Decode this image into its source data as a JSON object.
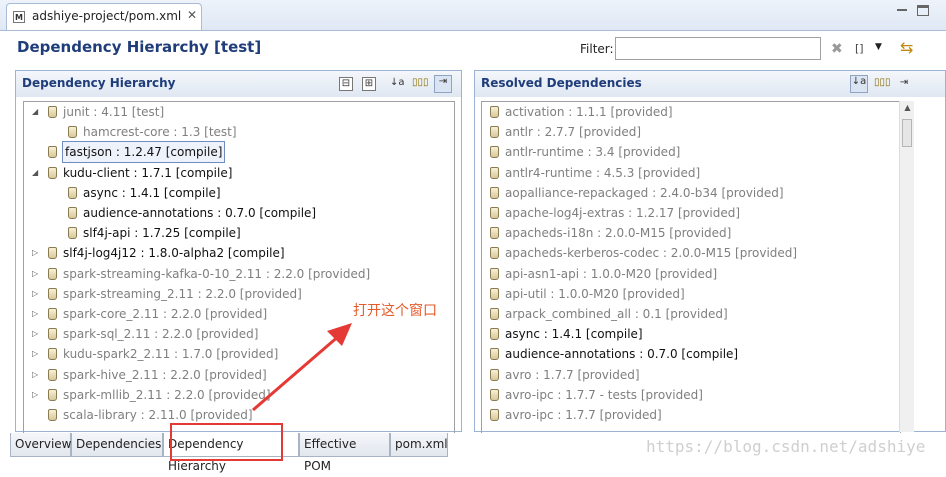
{
  "editor_tab": {
    "icon": "M",
    "title": "adshiye-project/pom.xml",
    "close": "✕"
  },
  "header": {
    "title": "Dependency Hierarchy [test]",
    "filter_label": "Filter:",
    "filter_value": "",
    "filter_placeholder": ""
  },
  "toolbar_icons": {
    "clear": "✖",
    "bracket": "[]",
    "dropdown": "▼",
    "sync": "⇆"
  },
  "left": {
    "title": "Dependency Hierarchy",
    "tools": [
      "⊟",
      "⊞",
      "↓a",
      "▯▯▯",
      "⇥"
    ],
    "items": [
      {
        "label": "junit : 4.11 [test]",
        "level": 0,
        "exp": "◢",
        "style": "grey"
      },
      {
        "label": "hamcrest-core : 1.3 [test]",
        "level": 1,
        "exp": "",
        "style": "grey"
      },
      {
        "label": "fastjson : 1.2.47 [compile]",
        "level": 0,
        "exp": "",
        "style": "dark sel"
      },
      {
        "label": "kudu-client : 1.7.1 [compile]",
        "level": 0,
        "exp": "◢",
        "style": "dark"
      },
      {
        "label": "async : 1.4.1 [compile]",
        "level": 1,
        "exp": "",
        "style": "dark"
      },
      {
        "label": "audience-annotations : 0.7.0 [compile]",
        "level": 1,
        "exp": "",
        "style": "dark"
      },
      {
        "label": "slf4j-api : 1.7.25 [compile]",
        "level": 1,
        "exp": "",
        "style": "dark"
      },
      {
        "label": "slf4j-log4j12 : 1.8.0-alpha2 [compile]",
        "level": 0,
        "exp": "▷",
        "style": "dark"
      },
      {
        "label": "spark-streaming-kafka-0-10_2.11 : 2.2.0 [provided]",
        "level": 0,
        "exp": "▷",
        "style": "grey"
      },
      {
        "label": "spark-streaming_2.11 : 2.2.0 [provided]",
        "level": 0,
        "exp": "▷",
        "style": "grey"
      },
      {
        "label": "spark-core_2.11 : 2.2.0 [provided]",
        "level": 0,
        "exp": "▷",
        "style": "grey"
      },
      {
        "label": "spark-sql_2.11 : 2.2.0 [provided]",
        "level": 0,
        "exp": "▷",
        "style": "grey"
      },
      {
        "label": "kudu-spark2_2.11 : 1.7.0 [provided]",
        "level": 0,
        "exp": "▷",
        "style": "grey"
      },
      {
        "label": "spark-hive_2.11 : 2.2.0 [provided]",
        "level": 0,
        "exp": "▷",
        "style": "grey"
      },
      {
        "label": "spark-mllib_2.11 : 2.2.0 [provided]",
        "level": 0,
        "exp": "▷",
        "style": "grey"
      },
      {
        "label": "scala-library : 2.11.0 [provided]",
        "level": 0,
        "exp": "",
        "style": "grey"
      }
    ]
  },
  "right": {
    "title": "Resolved Dependencies",
    "tools": [
      "↓a",
      "▯▯▯",
      "⇥"
    ],
    "items": [
      {
        "label": "activation : 1.1.1 [provided]",
        "style": "grey"
      },
      {
        "label": "antlr : 2.7.7 [provided]",
        "style": "grey"
      },
      {
        "label": "antlr-runtime : 3.4 [provided]",
        "style": "grey"
      },
      {
        "label": "antlr4-runtime : 4.5.3 [provided]",
        "style": "grey"
      },
      {
        "label": "aopalliance-repackaged : 2.4.0-b34 [provided]",
        "style": "grey"
      },
      {
        "label": "apache-log4j-extras : 1.2.17 [provided]",
        "style": "grey"
      },
      {
        "label": "apacheds-i18n : 2.0.0-M15 [provided]",
        "style": "grey"
      },
      {
        "label": "apacheds-kerberos-codec : 2.0.0-M15 [provided]",
        "style": "grey"
      },
      {
        "label": "api-asn1-api : 1.0.0-M20 [provided]",
        "style": "grey"
      },
      {
        "label": "api-util : 1.0.0-M20 [provided]",
        "style": "grey"
      },
      {
        "label": "arpack_combined_all : 0.1 [provided]",
        "style": "grey"
      },
      {
        "label": "async : 1.4.1 [compile]",
        "style": "dark"
      },
      {
        "label": "audience-annotations : 0.7.0 [compile]",
        "style": "dark"
      },
      {
        "label": "avro : 1.7.7 [provided]",
        "style": "grey"
      },
      {
        "label": "avro-ipc : 1.7.7 - tests [provided]",
        "style": "grey"
      },
      {
        "label": "avro-ipc : 1.7.7 [provided]",
        "style": "grey"
      }
    ]
  },
  "bottom_tabs": [
    "Overview",
    "Dependencies",
    "Dependency Hierarchy",
    "Effective POM",
    "pom.xml"
  ],
  "active_tab": "Dependency Hierarchy",
  "annotation": "打开这个窗口",
  "watermark": "https://blog.csdn.net/adshiye",
  "colors": {
    "title_blue": "#1f3d7a",
    "annotation_red": "#e53935",
    "panel_border": "#9db3d4"
  }
}
